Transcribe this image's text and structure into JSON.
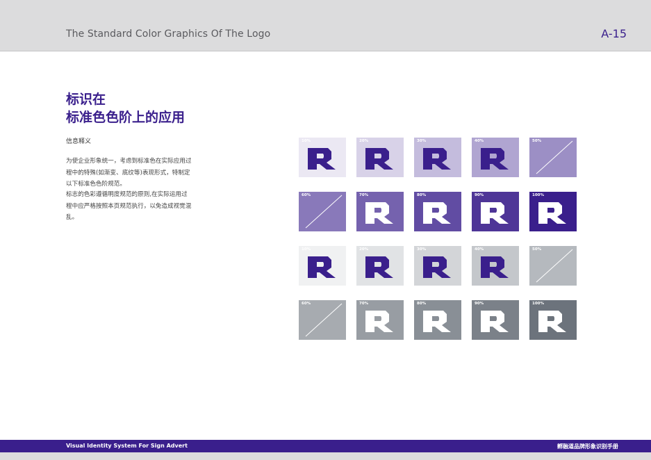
{
  "header": {
    "title": "The Standard Color Graphics Of The Logo",
    "page_number": "A-15"
  },
  "section": {
    "title_line1": "标识在",
    "title_line2": "标准色色阶上的应用",
    "subheading": "信息释义",
    "paragraph1_lines": [
      "为使企业形象统一，考虑到标准色在实际应用过",
      "程中的特殊(如渐变、底纹等)表现形式，特制定",
      "以下标准色色阶规范。"
    ],
    "paragraph2_lines": [
      "标志的色彩遵循明度规范的原则,在实际运用过",
      "程中应严格按照本页规范执行，以免造成视觉混",
      "乱。"
    ]
  },
  "swatch_rows": [
    {
      "tones": [
        {
          "label": "10%",
          "bg": "#ebe8f3",
          "content": "logo",
          "logo_color": "#3a1f8c"
        },
        {
          "label": "20%",
          "bg": "#d8d2e8",
          "content": "logo",
          "logo_color": "#3a1f8c"
        },
        {
          "label": "30%",
          "bg": "#c4bcdd",
          "content": "logo",
          "logo_color": "#3a1f8c"
        },
        {
          "label": "40%",
          "bg": "#b0a5d1",
          "content": "logo",
          "logo_color": "#3a1f8c"
        },
        {
          "label": "50%",
          "bg": "#9c8fc5",
          "content": "slash"
        }
      ]
    },
    {
      "tones": [
        {
          "label": "60%",
          "bg": "#8979ba",
          "content": "slash"
        },
        {
          "label": "70%",
          "bg": "#7562ae",
          "content": "logo",
          "logo_color": "#ffffff"
        },
        {
          "label": "80%",
          "bg": "#614ca3",
          "content": "logo",
          "logo_color": "#ffffff"
        },
        {
          "label": "90%",
          "bg": "#4e3597",
          "content": "logo",
          "logo_color": "#ffffff"
        },
        {
          "label": "100%",
          "bg": "#3a1f8c",
          "content": "logo",
          "logo_color": "#ffffff"
        }
      ]
    },
    {
      "tones": [
        {
          "label": "10%",
          "bg": "#f0f1f2",
          "content": "logo",
          "logo_color": "#3a1f8c"
        },
        {
          "label": "20%",
          "bg": "#e1e3e5",
          "content": "logo",
          "logo_color": "#3a1f8c"
        },
        {
          "label": "30%",
          "bg": "#d3d5d8",
          "content": "logo",
          "logo_color": "#3a1f8c"
        },
        {
          "label": "40%",
          "bg": "#c4c7cb",
          "content": "logo",
          "logo_color": "#3a1f8c"
        },
        {
          "label": "50%",
          "bg": "#b5b9be",
          "content": "slash"
        }
      ]
    },
    {
      "tones": [
        {
          "label": "60%",
          "bg": "#a7abb0",
          "content": "slash"
        },
        {
          "label": "70%",
          "bg": "#989da3",
          "content": "logo",
          "logo_color": "#ffffff"
        },
        {
          "label": "80%",
          "bg": "#898f96",
          "content": "logo",
          "logo_color": "#ffffff"
        },
        {
          "label": "90%",
          "bg": "#7b8189",
          "content": "logo",
          "logo_color": "#ffffff"
        },
        {
          "label": "100%",
          "bg": "#6c737c",
          "content": "logo",
          "logo_color": "#ffffff"
        }
      ]
    }
  ],
  "footer": {
    "left": "Visual Identity System For Sign Advert",
    "right": "孵融道品牌形象识别手册"
  },
  "colors": {
    "brand_purple": "#3a1f8c",
    "header_bg": "#dcdcdd",
    "brand_gray": "#6c737c"
  }
}
